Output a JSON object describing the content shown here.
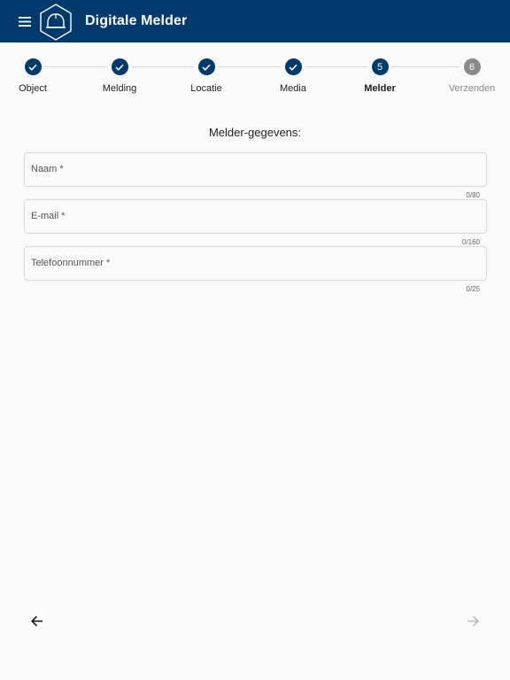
{
  "app": {
    "title": "Digitale Melder",
    "menu_icon": "hamburger-menu-icon",
    "logo_icon": "hexagon-helmet-logo",
    "bar_color": "#003a6c"
  },
  "stepper": {
    "steps": [
      {
        "label": "Object",
        "status": "done"
      },
      {
        "label": "Melding",
        "status": "done"
      },
      {
        "label": "Locatie",
        "status": "done"
      },
      {
        "label": "Media",
        "status": "done"
      },
      {
        "label": "Melder",
        "status": "active",
        "number": "5"
      },
      {
        "label": "Verzenden",
        "status": "pending",
        "number": "6"
      }
    ]
  },
  "form": {
    "title": "Melder-gegevens:",
    "fields": [
      {
        "label": "Naam *",
        "value": "",
        "counter": "0/80"
      },
      {
        "label": "E-mail *",
        "value": "",
        "counter": "0/160"
      },
      {
        "label": "Telefoonnummer *",
        "value": "",
        "counter": "0/25"
      }
    ]
  },
  "navigation": {
    "back_icon": "arrow-left-icon",
    "next_icon": "arrow-right-icon",
    "next_enabled": false
  }
}
